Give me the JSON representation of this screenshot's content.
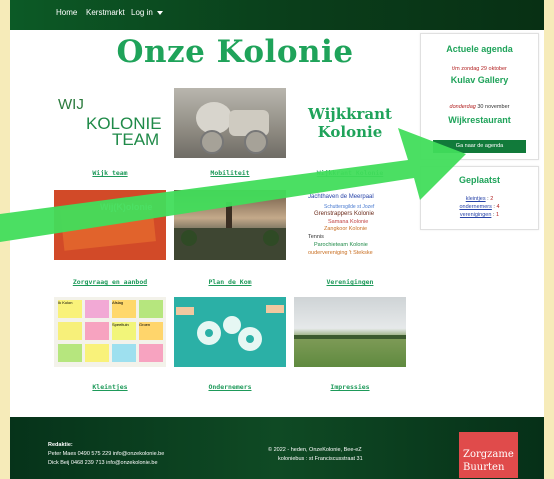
{
  "nav": {
    "home": "Home",
    "kerstmarkt": "Kerstmarkt",
    "login": "Log in"
  },
  "title": "Onze Kolonie",
  "tiles": [
    {
      "label": "Wijk team",
      "logo_line1": "WIJ",
      "logo_line2": "KOLONIE",
      "logo_line3": "TEAM"
    },
    {
      "label": "Mobiliteit"
    },
    {
      "label": "Wijkkrant Kolonie",
      "text_line1": "Wijkkrant",
      "text_line2": "Kolonie"
    },
    {
      "label": "Zorgvraag en aanbod",
      "brochure_text": "Wij(K)olonie"
    },
    {
      "label": "Plan de Kom"
    },
    {
      "label": "Verenigingen",
      "cloud": [
        "Jachthaven de Meerpaal",
        "Schuttersgilde st Jozef",
        "Grenstrappers Kolonie",
        "Samana Kolonie",
        "Zangkoor Kolonie",
        "Tennis",
        "Parochieteam Kolonie",
        "oudervereniging 't Stekske"
      ]
    },
    {
      "label": "Kleintjes",
      "notes": [
        "Ik Kolon",
        "Afslag",
        "Speeltuin",
        "Groen"
      ]
    },
    {
      "label": "Ondernemers"
    },
    {
      "label": "Impressies"
    }
  ],
  "agenda": {
    "title": "Actuele agenda",
    "event1_date": "t/m zondag 29 oktober",
    "event1_name": "Kulav Gallery",
    "event2_day": "donderdag",
    "event2_date": "30 november",
    "event2_name": "Wijkrestaurant",
    "button": "Ga naar de agenda"
  },
  "geplaatst": {
    "title": "Geplaatst",
    "items": [
      {
        "label": "kleintjes",
        "count": "2"
      },
      {
        "label": "ondernemers",
        "count": "4"
      },
      {
        "label": "verenigingen",
        "count": "1"
      }
    ]
  },
  "footer": {
    "redaktie": "Redaktie:",
    "line1": "Peter Maes 0490 575 229 info@onzekolonie.be",
    "line2": "Dick Beij    0468 239 713 info@onzekolonie.be",
    "copyright": "© 2022 - heden, OnzeKolonie, Bee-eZ",
    "address": "koloniebus : st Franciscusstraat 31",
    "logo_line1": "Zorgzame",
    "logo_line2": "Buurten"
  },
  "colors": {
    "brand_green": "#1fa35a",
    "dark_green": "#0c5a26",
    "arrow_green": "#3fe05d",
    "background": "#f6ebb9"
  }
}
